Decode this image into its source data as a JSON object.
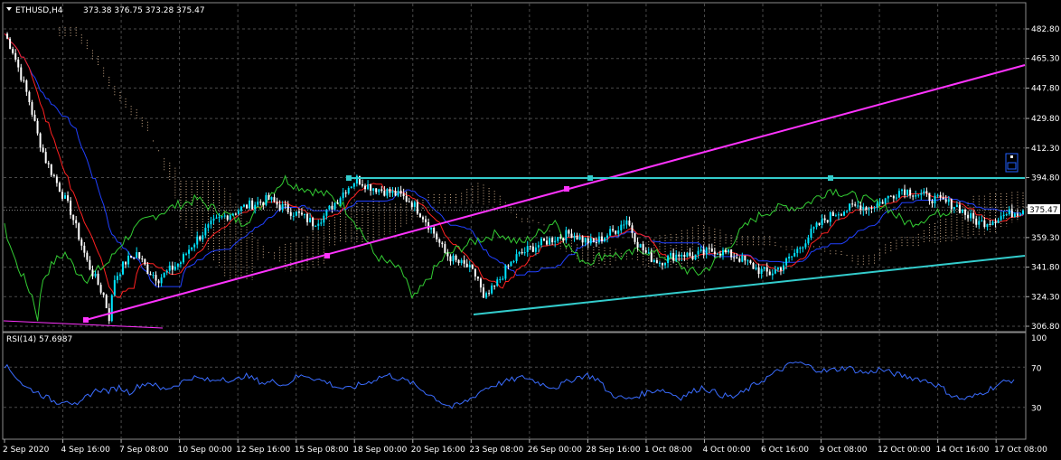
{
  "header": {
    "symbol": "ETHUSD,H4",
    "ohlc": "373.38 376.75 373.28 375.47"
  },
  "rsi_header": "RSI(14) 57.6987",
  "colors": {
    "background": "#000000",
    "grid": "#4a4a4a",
    "bull_candle": "#00e5ff",
    "bear_candle": "#ffffff",
    "trendline_magenta": "#ff33ff",
    "trendline_cyan": "#33cccc",
    "tenkan": "#ff2020",
    "kijun": "#2040ff",
    "chikou": "#33cc33",
    "cloud": "#f0c8a0",
    "rsi_line": "#3a6cff"
  },
  "chart_data": [
    {
      "type": "candlestick",
      "title": "ETHUSD,H4",
      "yticks": [
        482.8,
        465.3,
        447.8,
        429.8,
        412.3,
        394.8,
        377.3,
        359.3,
        341.8,
        324.3,
        306.8
      ],
      "ytick_labels": [
        "482.80",
        "465.30",
        "447.80",
        "429.80",
        "412.30",
        "394.80",
        "",
        "359.30",
        "341.80",
        "324.30",
        "306.80"
      ],
      "ylim": [
        304,
        490
      ],
      "current_price_label": "375.47",
      "current_price": 375.47,
      "xtick_labels": [
        "2 Sep 2020",
        "4 Sep 16:00",
        "7 Sep 08:00",
        "10 Sep 00:00",
        "12 Sep 16:00",
        "15 Sep 08:00",
        "18 Sep 00:00",
        "20 Sep 16:00",
        "23 Sep 08:00",
        "26 Sep 00:00",
        "28 Sep 16:00",
        "1 Oct 08:00",
        "4 Oct 00:00",
        "6 Oct 16:00",
        "9 Oct 08:00",
        "12 Oct 00:00",
        "14 Oct 16:00",
        "17 Oct 08:00"
      ],
      "close_path": [
        [
          0,
          480
        ],
        [
          3,
          470
        ],
        [
          6,
          455
        ],
        [
          9,
          440
        ],
        [
          12,
          420
        ],
        [
          15,
          405
        ],
        [
          18,
          395
        ],
        [
          21,
          385
        ],
        [
          24,
          375
        ],
        [
          27,
          360
        ],
        [
          30,
          345
        ],
        [
          33,
          335
        ],
        [
          36,
          325
        ],
        [
          38,
          312
        ],
        [
          40,
          335
        ],
        [
          44,
          345
        ],
        [
          48,
          350
        ],
        [
          52,
          340
        ],
        [
          56,
          335
        ],
        [
          60,
          340
        ],
        [
          64,
          345
        ],
        [
          68,
          355
        ],
        [
          72,
          362
        ],
        [
          76,
          368
        ],
        [
          80,
          372
        ],
        [
          84,
          375
        ],
        [
          88,
          378
        ],
        [
          92,
          380
        ],
        [
          96,
          382
        ],
        [
          100,
          378
        ],
        [
          104,
          375
        ],
        [
          108,
          372
        ],
        [
          112,
          368
        ],
        [
          116,
          372
        ],
        [
          120,
          380
        ],
        [
          124,
          388
        ],
        [
          128,
          394
        ],
        [
          132,
          390
        ],
        [
          136,
          388
        ],
        [
          140,
          386
        ],
        [
          144,
          384
        ],
        [
          148,
          380
        ],
        [
          152,
          372
        ],
        [
          156,
          362
        ],
        [
          160,
          350
        ],
        [
          164,
          345
        ],
        [
          168,
          342
        ],
        [
          172,
          335
        ],
        [
          174,
          322
        ],
        [
          178,
          330
        ],
        [
          182,
          340
        ],
        [
          186,
          348
        ],
        [
          190,
          352
        ],
        [
          194,
          355
        ],
        [
          198,
          358
        ],
        [
          202,
          360
        ],
        [
          206,
          362
        ],
        [
          210,
          358
        ],
        [
          214,
          356
        ],
        [
          218,
          360
        ],
        [
          222,
          364
        ],
        [
          226,
          370
        ],
        [
          230,
          356
        ],
        [
          234,
          348
        ],
        [
          238,
          345
        ],
        [
          242,
          348
        ],
        [
          246,
          350
        ],
        [
          250,
          348
        ],
        [
          254,
          350
        ],
        [
          258,
          352
        ],
        [
          262,
          350
        ],
        [
          266,
          348
        ],
        [
          270,
          344
        ],
        [
          274,
          340
        ],
        [
          278,
          338
        ],
        [
          282,
          342
        ],
        [
          286,
          348
        ],
        [
          290,
          356
        ],
        [
          294,
          364
        ],
        [
          298,
          370
        ],
        [
          302,
          374
        ],
        [
          306,
          376
        ],
        [
          310,
          378
        ],
        [
          314,
          377
        ],
        [
          318,
          380
        ],
        [
          322,
          384
        ],
        [
          326,
          388
        ],
        [
          330,
          386
        ],
        [
          334,
          384
        ],
        [
          338,
          382
        ],
        [
          342,
          380
        ],
        [
          346,
          378
        ],
        [
          350,
          372
        ],
        [
          354,
          368
        ],
        [
          358,
          369
        ],
        [
          362,
          372
        ],
        [
          366,
          374
        ],
        [
          370,
          375.47
        ]
      ]
    },
    {
      "type": "line",
      "title": "RSI(14) 57.6987",
      "ylim": [
        0,
        100
      ],
      "yticks": [
        100,
        70,
        30
      ],
      "ytick_labels": [
        "100",
        "70",
        "30"
      ],
      "values": [
        72,
        62,
        50,
        46,
        40,
        35,
        38,
        30,
        42,
        48,
        46,
        50,
        45,
        52,
        55,
        48,
        50,
        55,
        60,
        58,
        56,
        60,
        55,
        62,
        58,
        54,
        56,
        52,
        60,
        62,
        58,
        55,
        50,
        48,
        52,
        55,
        60,
        62,
        58,
        55,
        48,
        42,
        35,
        30,
        34,
        40,
        48,
        52,
        55,
        58,
        60,
        56,
        52,
        50,
        55,
        60,
        62,
        58,
        45,
        40,
        38,
        42,
        46,
        48,
        44,
        40,
        45,
        50,
        46,
        42,
        40,
        45,
        52,
        58,
        64,
        70,
        75,
        72,
        68,
        66,
        68,
        70,
        66,
        64,
        68,
        65,
        62,
        60,
        58,
        55,
        50,
        42,
        38,
        40,
        45,
        50,
        55,
        57.7
      ]
    }
  ]
}
